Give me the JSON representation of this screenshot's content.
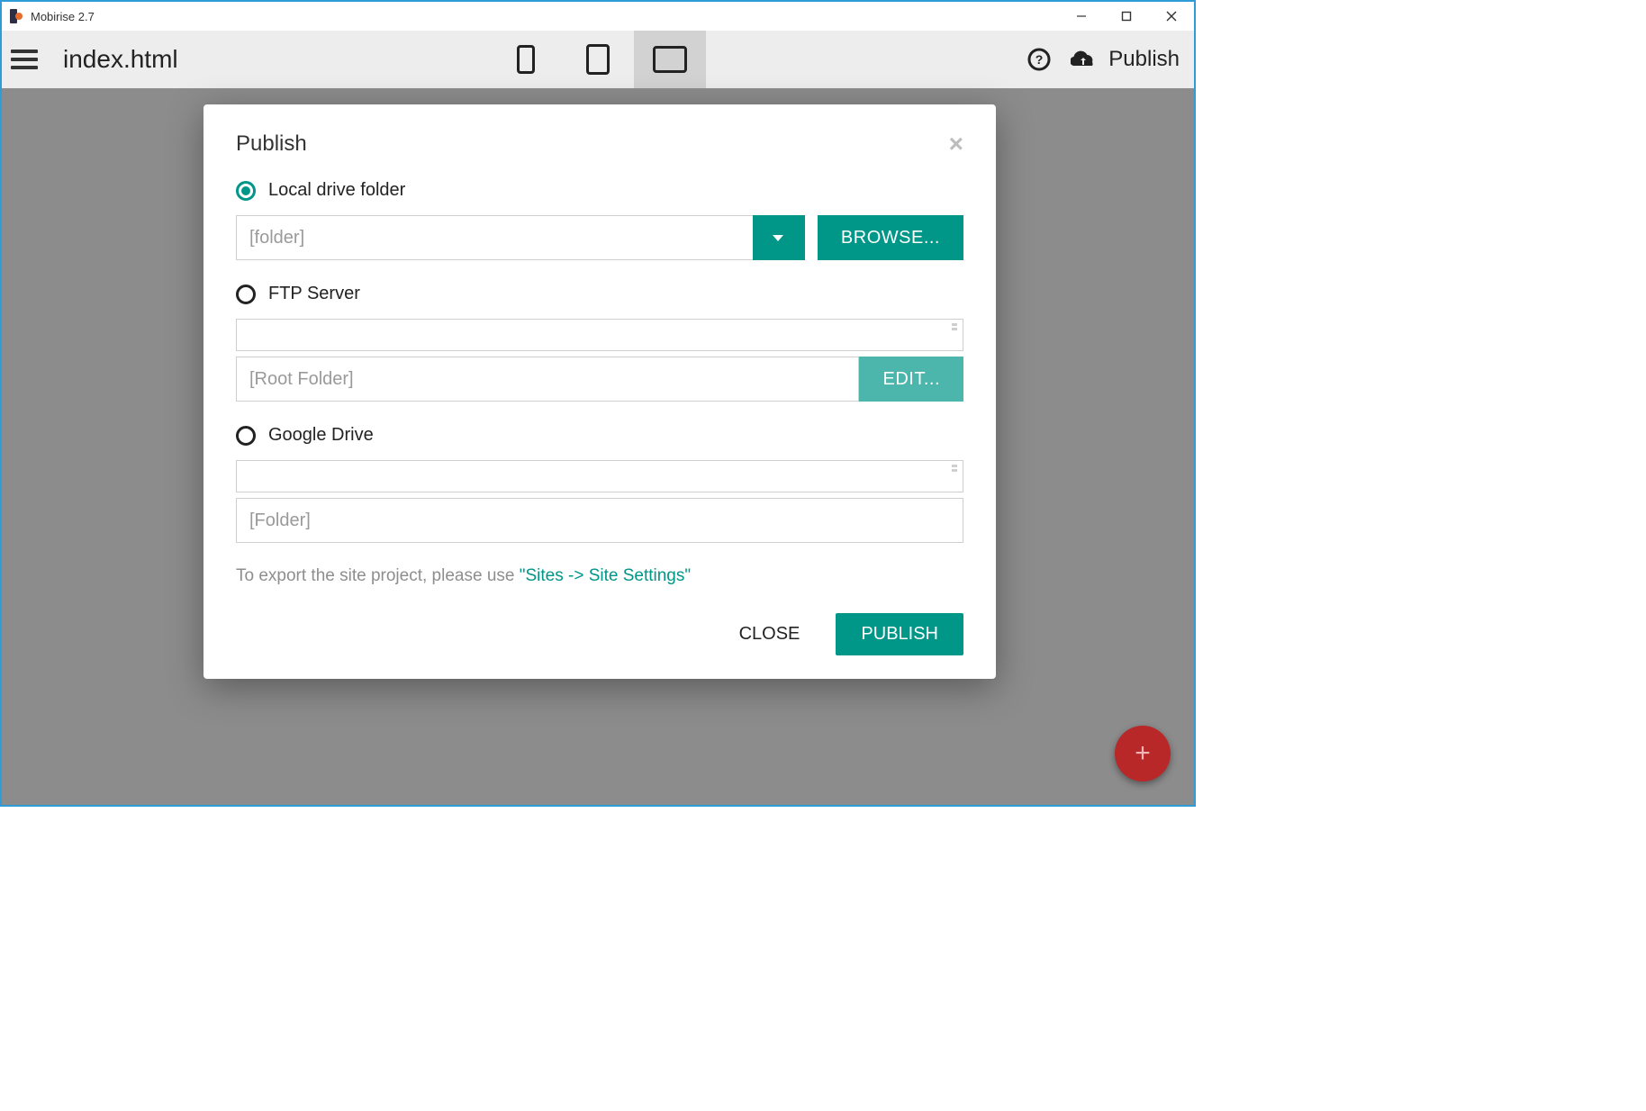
{
  "window": {
    "title": "Mobirise 2.7"
  },
  "toolbar": {
    "page_title": "index.html",
    "publish_label": "Publish"
  },
  "modal": {
    "title": "Publish",
    "close_glyph": "×",
    "options": {
      "local": {
        "label": "Local drive folder",
        "placeholder": "[folder]",
        "browse_label": "BROWSE..."
      },
      "ftp": {
        "label": "FTP Server",
        "root_placeholder": "[Root Folder]",
        "edit_label": "EDIT..."
      },
      "gdrive": {
        "label": "Google Drive",
        "folder_placeholder": "[Folder]"
      }
    },
    "hint_prefix": "To export the site project, please use ",
    "hint_link": "\"Sites -> Site Settings\"",
    "close_label": "CLOSE",
    "publish_label": "PUBLISH"
  },
  "fab": {
    "glyph": "+"
  }
}
